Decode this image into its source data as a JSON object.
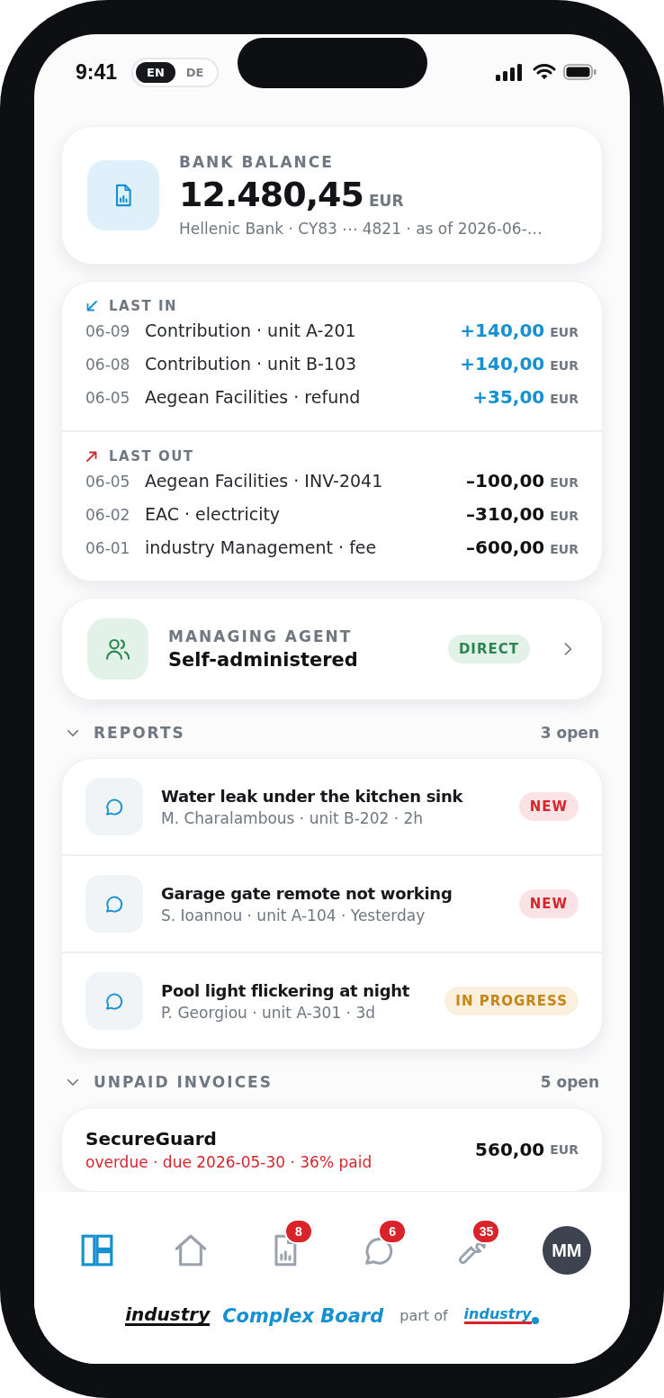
{
  "status_bar": {
    "time": "9:41",
    "languages": [
      {
        "label": "EN",
        "selected": true
      },
      {
        "label": "DE",
        "selected": false
      }
    ]
  },
  "balance_card": {
    "label": "BANK BALANCE",
    "amount": "12.480,45",
    "currency": "EUR",
    "details": "Hellenic Bank · CY83 ⋯ 4821 · as of 2026-06-…"
  },
  "transactions": [
    {
      "kind": "in",
      "title": "LAST IN",
      "rows": [
        {
          "date": "06-09",
          "description": "Contribution · unit A-201",
          "amount": "+140,00",
          "currency": "EUR"
        },
        {
          "date": "06-08",
          "description": "Contribution · unit B-103",
          "amount": "+140,00",
          "currency": "EUR"
        },
        {
          "date": "06-05",
          "description": "Aegean Facilities · refund",
          "amount": "+35,00",
          "currency": "EUR"
        }
      ]
    },
    {
      "kind": "out",
      "title": "LAST OUT",
      "rows": [
        {
          "date": "06-05",
          "description": "Aegean Facilities · INV-2041",
          "amount": "–100,00",
          "currency": "EUR"
        },
        {
          "date": "06-02",
          "description": "EAC · electricity",
          "amount": "–310,00",
          "currency": "EUR"
        },
        {
          "date": "06-01",
          "description": "industry Management · fee",
          "amount": "–600,00",
          "currency": "EUR"
        }
      ]
    }
  ],
  "agent": {
    "label": "MANAGING AGENT",
    "value": "Self-administered",
    "badge": "DIRECT"
  },
  "reports": {
    "title": "REPORTS",
    "count": "3 open",
    "expanded": true,
    "items": [
      {
        "title": "Water leak under the kitchen sink",
        "meta": "M. Charalambous · unit B-202 · 2h",
        "status": "NEW",
        "kind": "new"
      },
      {
        "title": "Garage gate remote not working",
        "meta": "S. Ioannou · unit A-104 · Yesterday",
        "status": "NEW",
        "kind": "new"
      },
      {
        "title": "Pool light flickering at night",
        "meta": "P. Georgiou · unit A-301 · 3d",
        "status": "IN PROGRESS",
        "kind": "progress"
      }
    ]
  },
  "invoices": {
    "title": "UNPAID INVOICES",
    "count": "5 open",
    "expanded": true,
    "items": [
      {
        "vendor": "SecureGuard",
        "meta": "overdue · due 2026-05-30 · 36% paid",
        "amount": "560,00",
        "currency": "EUR",
        "overdue": true
      }
    ]
  },
  "tab_bar": [
    {
      "kind": "dashboard",
      "selected": true
    },
    {
      "kind": "home",
      "selected": false
    },
    {
      "kind": "report",
      "selected": false,
      "badge": "8"
    },
    {
      "kind": "chat",
      "selected": false,
      "badge": "6"
    },
    {
      "kind": "wrench",
      "selected": false,
      "badge": "35"
    },
    {
      "kind": "avatar",
      "selected": false,
      "label": "MM"
    }
  ],
  "footer": {
    "brand": "industry",
    "product": "Complex Board",
    "connector": "part of",
    "parent": "industry"
  }
}
